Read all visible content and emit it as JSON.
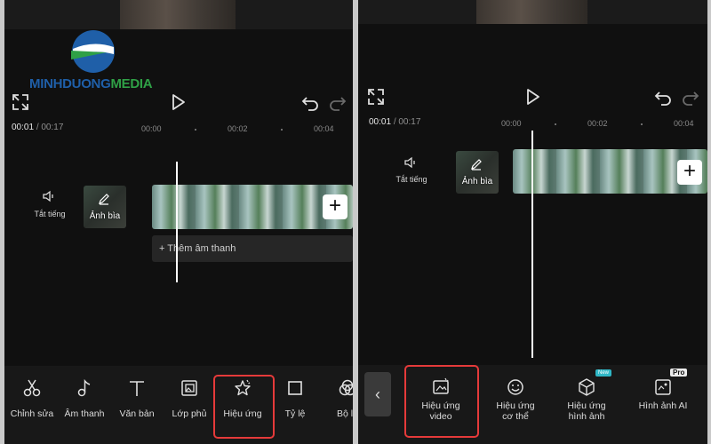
{
  "watermark": {
    "text": "MINHDUONGMEDIA",
    "colors": {
      "primary": "#1f5fa8",
      "green": "#2fa046"
    }
  },
  "left": {
    "time_current": "00:01",
    "time_sep": "/",
    "time_total": "00:17",
    "ticks": [
      "00:00",
      "00:02",
      "00:04"
    ],
    "mute_label": "Tắt tiếng",
    "cover_label": "Ảnh bìa",
    "add_audio": "+ Thêm âm thanh",
    "add_clip": "+",
    "tools": [
      {
        "label": "Chỉnh sửa",
        "icon": "scissors-icon"
      },
      {
        "label": "Âm thanh",
        "icon": "music-note-icon"
      },
      {
        "label": "Văn bản",
        "icon": "text-icon"
      },
      {
        "label": "Lớp phủ",
        "icon": "overlay-icon"
      },
      {
        "label": "Hiệu ứng",
        "icon": "effects-star-icon"
      },
      {
        "label": "Tỷ lệ",
        "icon": "ratio-square-icon"
      },
      {
        "label": "Bộ lọ",
        "icon": "filter-icon"
      }
    ]
  },
  "right": {
    "time_current": "00:01",
    "time_sep": "/",
    "time_total": "00:17",
    "ticks": [
      "00:00",
      "00:02",
      "00:04"
    ],
    "mute_label": "Tắt tiếng",
    "cover_label": "Ảnh bìa",
    "add_clip": "+",
    "back": "‹",
    "tools": [
      {
        "label_line1": "Hiệu ứng",
        "label_line2": "video",
        "icon": "video-effect-icon"
      },
      {
        "label_line1": "Hiệu ứng",
        "label_line2": "cơ thể",
        "icon": "body-effect-icon"
      },
      {
        "label_line1": "Hiệu ứng",
        "label_line2": "hình ảnh",
        "icon": "image-effect-icon",
        "badge": "New"
      },
      {
        "label_line1": "Hình ảnh AI",
        "label_line2": "",
        "icon": "ai-image-icon",
        "badge": "Pro"
      }
    ]
  }
}
